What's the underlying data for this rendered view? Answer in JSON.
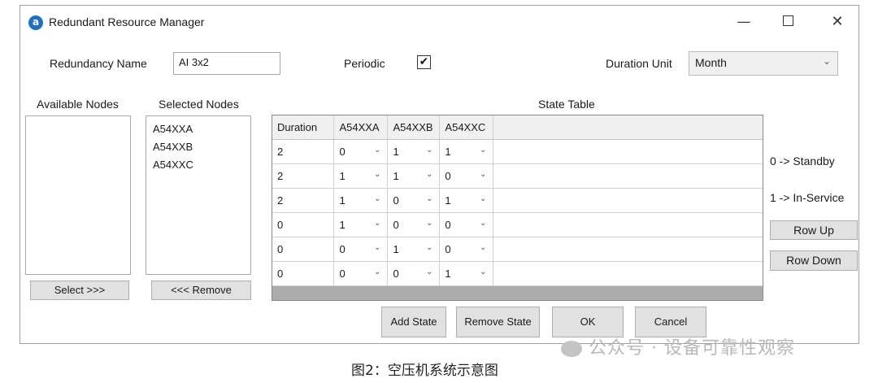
{
  "window": {
    "title": "Redundant Resource Manager",
    "app_icon_glyph": "a",
    "minimize_glyph": "—",
    "close_glyph": "✕"
  },
  "form": {
    "redundancy_name_label": "Redundancy Name",
    "redundancy_name_value": "AI 3x2",
    "periodic_label": "Periodic",
    "periodic_checked": true,
    "periodic_check_glyph": "✔",
    "duration_unit_label": "Duration Unit",
    "duration_unit_value": "Month",
    "dropdown_arrow_glyph": "⌄"
  },
  "nodes": {
    "available_label": "Available Nodes",
    "selected_label": "Selected Nodes",
    "available_items": [],
    "selected_items": [
      "A54XXA",
      "A54XXB",
      "A54XXC"
    ],
    "select_button": "Select >>>",
    "remove_button": "<<< Remove"
  },
  "state_table": {
    "label": "State Table",
    "columns": [
      "Duration",
      "A54XXA",
      "A54XXB",
      "A54XXC"
    ],
    "rows": [
      [
        "2",
        "0",
        "1",
        "1"
      ],
      [
        "2",
        "1",
        "1",
        "0"
      ],
      [
        "2",
        "1",
        "0",
        "1"
      ],
      [
        "0",
        "1",
        "0",
        "0"
      ],
      [
        "0",
        "0",
        "1",
        "0"
      ],
      [
        "0",
        "0",
        "0",
        "1"
      ]
    ],
    "cell_arrow_glyph": "⌄"
  },
  "legend": {
    "standby": "0 -> Standby",
    "in_service": "1 -> In-Service"
  },
  "buttons": {
    "row_up": "Row Up",
    "row_down": "Row Down",
    "add_state": "Add State",
    "remove_state": "Remove State",
    "ok": "OK",
    "cancel": "Cancel"
  },
  "caption": "图2：空压机系统示意图",
  "watermark": "公众号 · 设备可靠性观察",
  "icons": {
    "app": "app-logo-icon",
    "minimize": "minimize-icon",
    "maximize": "maximize-icon",
    "close": "close-icon",
    "wechat": "wechat-icon"
  }
}
